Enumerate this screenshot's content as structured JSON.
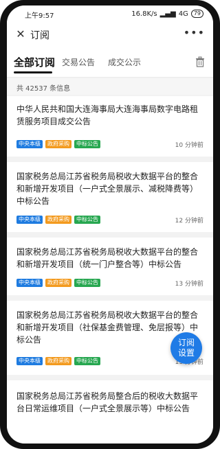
{
  "status": {
    "time": "上午9:57",
    "network": "16.8K/s",
    "signal": "4G",
    "battery": "79"
  },
  "header": {
    "title": "订阅"
  },
  "tabs": [
    {
      "label": "全部订阅"
    },
    {
      "label": "交易公告"
    },
    {
      "label": "成交公示"
    }
  ],
  "summary": {
    "count_text": "共 42537 条信息"
  },
  "cards": [
    {
      "title": "中华人民共和国大连海事局大连海事局数字电路租赁服务项目成交公告",
      "tags": [
        "中央本级",
        "政府采购",
        "中标公告"
      ],
      "time": "10 分钟前"
    },
    {
      "title": "国家税务总局江苏省税务局税收大数据平台的整合和新增开发项目（一户式全景展示、减税降费等）中标公告",
      "tags": [
        "中央本级",
        "政府采购",
        "中标公告"
      ],
      "time": "12 分钟前"
    },
    {
      "title": "国家税务总局江苏省税务局税收大数据平台的整合和新增开发项目（统一门户整合等）中标公告",
      "tags": [
        "中央本级",
        "政府采购",
        "中标公告"
      ],
      "time": "13 分钟前"
    },
    {
      "title": "国家税务总局江苏省税务局税收大数据平台的整合和新增开发项目（社保基金费管理、免层报等）中标公告",
      "tags": [
        "中央本级",
        "政府采购",
        "中标公告"
      ],
      "time": "13 分钟前"
    },
    {
      "title": "国家税务总局江苏省税务局整合后的税收大数据平台日常运维项目（一户式全景展示等）中标公告",
      "tags": [],
      "time": ""
    }
  ],
  "fab": {
    "label": "订阅设置"
  },
  "colors": {
    "accent": "#1f7be6",
    "tag_blue": "#1e7be0",
    "tag_orange": "#f39a1e",
    "tag_green": "#27a750"
  }
}
